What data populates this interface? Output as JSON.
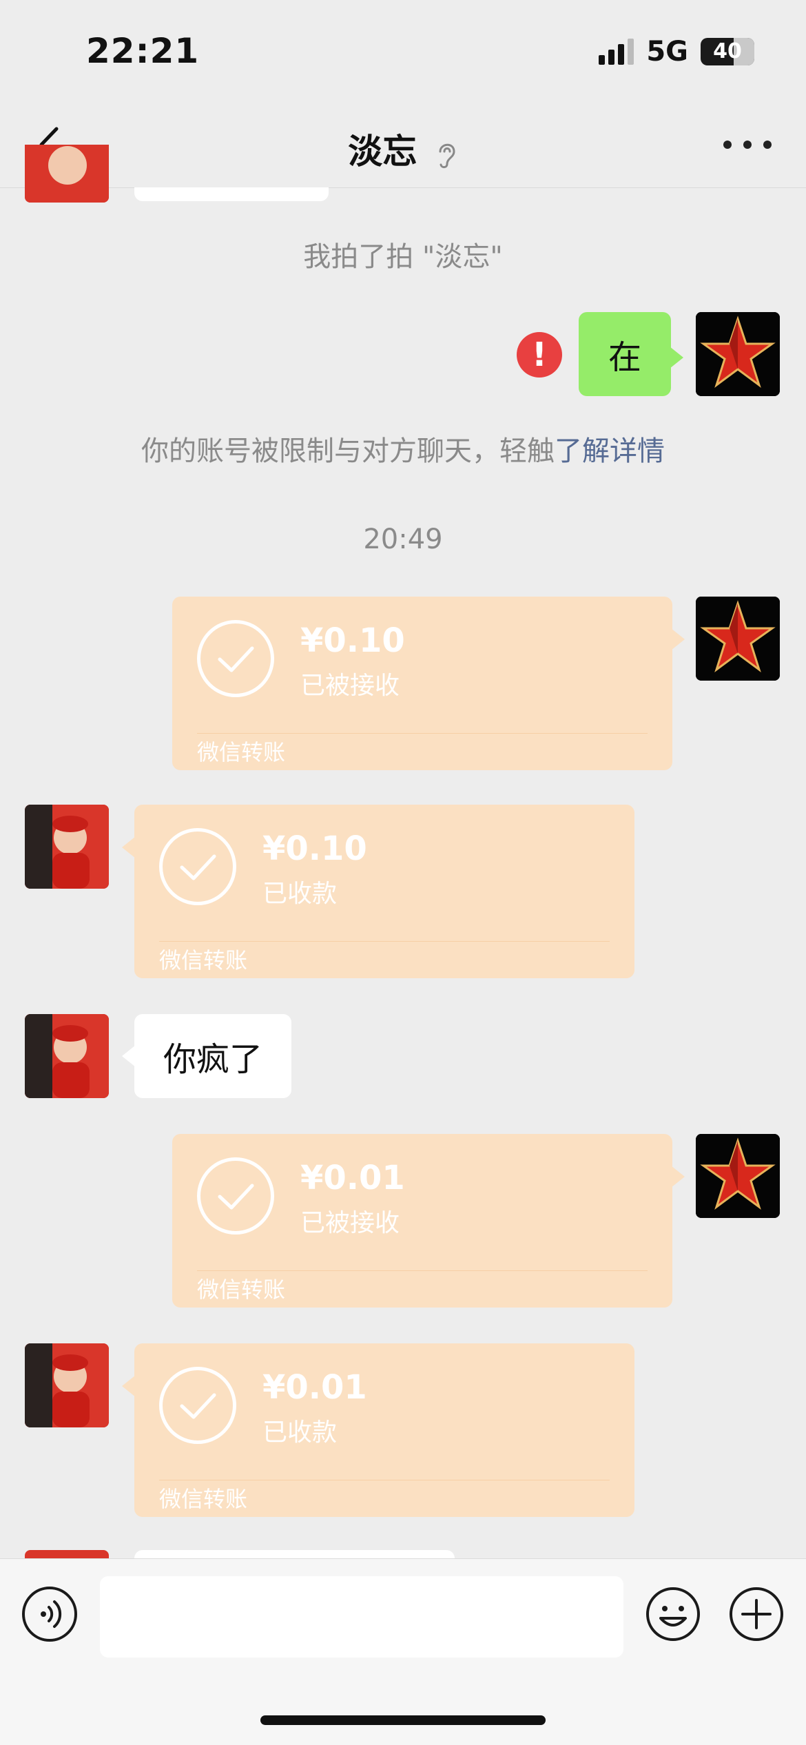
{
  "status_bar": {
    "time": "22:21",
    "network": "5G",
    "battery": "40"
  },
  "header": {
    "title": "淡忘"
  },
  "messages": {
    "pat_notice": "我拍了拍 \"淡忘\"",
    "sent_text": "在",
    "error_mark": "!",
    "restriction_notice": "你的账号被限制与对方聊天，轻触",
    "restriction_link": "了解详情",
    "timestamp": "20:49",
    "transfers": [
      {
        "amount": "¥0.10",
        "status": "已被接收",
        "footer": "微信转账"
      },
      {
        "amount": "¥0.10",
        "status": "已收款",
        "footer": "微信转账"
      },
      {
        "amount": "¥0.01",
        "status": "已被接收",
        "footer": "微信转账"
      },
      {
        "amount": "¥0.01",
        "status": "已收款",
        "footer": "微信转账"
      }
    ],
    "received_text": "你疯了"
  },
  "input_bar": {
    "value": ""
  },
  "colors": {
    "background": "#ededed",
    "sent_bubble": "#95ec69",
    "transfer_card": "#fbe0c2",
    "link": "#566b94",
    "error": "#e84040"
  },
  "icons": {
    "back": "chevron-left-icon",
    "mute": "ear-icon",
    "more": "more-dots-icon",
    "voice": "voice-icon",
    "emoji": "emoji-icon",
    "plus": "plus-icon",
    "check": "check-circle-icon"
  }
}
